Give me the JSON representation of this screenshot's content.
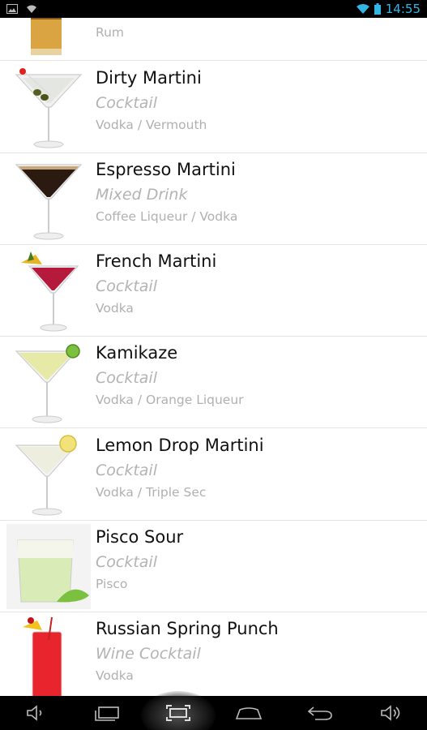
{
  "status_bar": {
    "time": "14:55",
    "icons": [
      "image-notification-icon",
      "wifi-notification-icon",
      "wifi-signal-icon",
      "battery-icon"
    ],
    "accent_color": "#33b5e5"
  },
  "drinks": [
    {
      "name": "",
      "type": "",
      "ingredients": "Rum",
      "thumb": "rum-glass"
    },
    {
      "name": "Dirty Martini",
      "type": "Cocktail",
      "ingredients": "Vodka / Vermouth",
      "thumb": "martini-olive"
    },
    {
      "name": "Espresso Martini",
      "type": "Mixed Drink",
      "ingredients": "Coffee Liqueur / Vodka",
      "thumb": "martini-espresso"
    },
    {
      "name": "French Martini",
      "type": "Cocktail",
      "ingredients": "Vodka",
      "thumb": "martini-red-pineapple"
    },
    {
      "name": "Kamikaze",
      "type": "Cocktail",
      "ingredients": "Vodka / Orange Liqueur",
      "thumb": "martini-lime"
    },
    {
      "name": "Lemon Drop Martini",
      "type": "Cocktail",
      "ingredients": "Vodka / Triple Sec",
      "thumb": "martini-lemon"
    },
    {
      "name": "Pisco Sour",
      "type": "Cocktail",
      "ingredients": "Pisco",
      "thumb": "sour-glass"
    },
    {
      "name": "Russian Spring Punch",
      "type": "Wine Cocktail",
      "ingredients": "Vodka",
      "thumb": "highball-red"
    }
  ],
  "nav_bar": {
    "buttons": [
      "volume-down-icon",
      "back-recent-icon",
      "screenshot-icon",
      "home-icon",
      "back-icon",
      "volume-up-icon"
    ],
    "active": "screenshot-icon"
  }
}
